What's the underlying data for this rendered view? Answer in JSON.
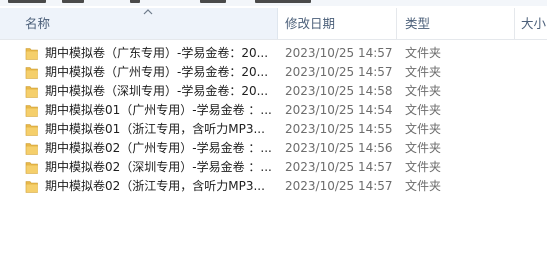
{
  "columns": {
    "name": "名称",
    "date": "修改日期",
    "type": "类型",
    "size": "大小"
  },
  "sort_indicator_icon": "sort-ascending-icon",
  "icon": "folder-icon",
  "colors": {
    "folder": "#e8b84a",
    "header_text": "#4c607a",
    "meta_text": "#6d6d6d"
  },
  "files": [
    {
      "name": "期中模拟卷（广东专用）-学易金卷：20...",
      "date": "2023/10/25 14:57",
      "type": "文件夹"
    },
    {
      "name": "期中模拟卷（广州专用）-学易金卷：20...",
      "date": "2023/10/25 14:57",
      "type": "文件夹"
    },
    {
      "name": "期中模拟卷（深圳专用）-学易金卷：20...",
      "date": "2023/10/25 14:58",
      "type": "文件夹"
    },
    {
      "name": "期中模拟卷01（广州专用）-学易金卷 ：...",
      "date": "2023/10/25 14:54",
      "type": "文件夹"
    },
    {
      "name": "期中模拟卷01（浙江专用，含听力MP3...",
      "date": "2023/10/25 14:55",
      "type": "文件夹"
    },
    {
      "name": "期中模拟卷02（广州专用）-学易金卷 ：...",
      "date": "2023/10/25 14:56",
      "type": "文件夹"
    },
    {
      "name": "期中模拟卷02（深圳专用）-学易金卷 ：...",
      "date": "2023/10/25 14:57",
      "type": "文件夹"
    },
    {
      "name": "期中模拟卷02（浙江专用，含听力MP3...",
      "date": "2023/10/25 14:57",
      "type": "文件夹"
    }
  ]
}
